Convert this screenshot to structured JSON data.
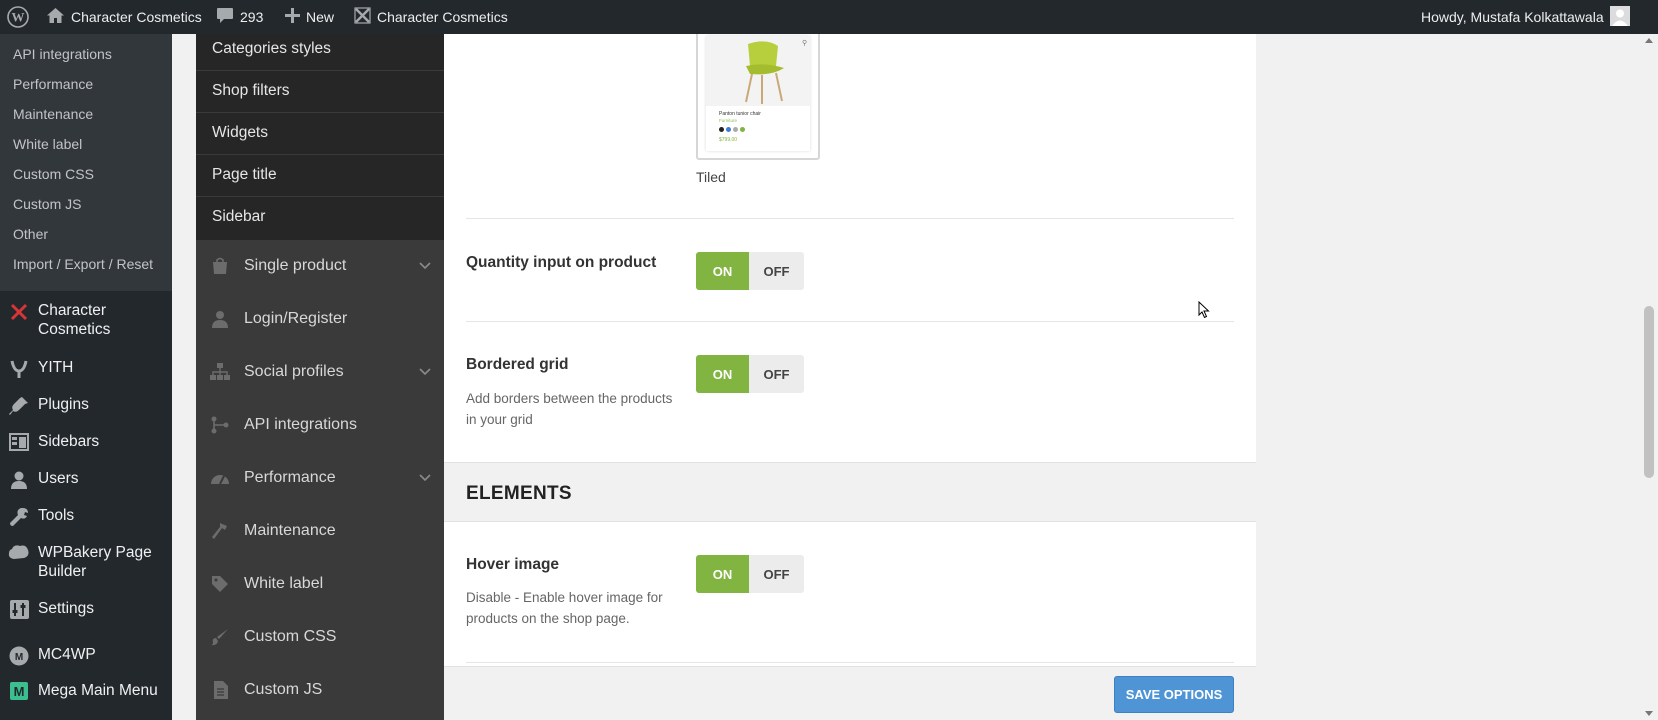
{
  "adminbar": {
    "site_name": "Character Cosmetics",
    "comments_count": "293",
    "new_label": "New",
    "theme_link": "Character Cosmetics",
    "greeting": "Howdy, Mustafa Kolkattawala"
  },
  "admin_submenu": [
    "API integrations",
    "Performance",
    "Maintenance",
    "White label",
    "Custom CSS",
    "Custom JS",
    "Other",
    "Import / Export / Reset"
  ],
  "admin_menu": [
    {
      "label": "Character Cosmetics",
      "icon": "theme-x-icon"
    },
    {
      "label": "YITH",
      "icon": "yith-icon"
    },
    {
      "label": "Plugins",
      "icon": "plugins-icon"
    },
    {
      "label": "Sidebars",
      "icon": "sidebars-icon"
    },
    {
      "label": "Users",
      "icon": "users-icon"
    },
    {
      "label": "Tools",
      "icon": "tools-icon"
    },
    {
      "label": "WPBakery Page Builder",
      "icon": "wpbakery-icon"
    },
    {
      "label": "Settings",
      "icon": "settings-icon"
    },
    {
      "label": "MC4WP",
      "icon": "mc4wp-icon"
    },
    {
      "label": "Mega Main Menu",
      "icon": "mega-menu-icon"
    }
  ],
  "options_subnav": [
    "Categories styles",
    "Shop filters",
    "Widgets",
    "Page title",
    "Sidebar"
  ],
  "options_nav": [
    {
      "label": "Single product",
      "icon": "bag-icon",
      "expandable": true
    },
    {
      "label": "Login/Register",
      "icon": "user-icon",
      "expandable": false
    },
    {
      "label": "Social profiles",
      "icon": "sitemap-icon",
      "expandable": true
    },
    {
      "label": "API integrations",
      "icon": "api-icon",
      "expandable": false
    },
    {
      "label": "Performance",
      "icon": "dashboard-icon",
      "expandable": true
    },
    {
      "label": "Maintenance",
      "icon": "hammer-icon",
      "expandable": false
    },
    {
      "label": "White label",
      "icon": "tag-icon",
      "expandable": false
    },
    {
      "label": "Custom CSS",
      "icon": "brush-icon",
      "expandable": false
    },
    {
      "label": "Custom JS",
      "icon": "file-icon",
      "expandable": false
    }
  ],
  "content": {
    "preview": {
      "label": "Tiled",
      "product_name": "Panton tunior chair",
      "product_category": "Furniture",
      "product_price": "$799.00"
    },
    "options": [
      {
        "title": "Quantity input on product",
        "description": "",
        "on": "ON",
        "off": "OFF",
        "value": "on"
      },
      {
        "title": "Bordered grid",
        "description": "Add borders between the products in your grid",
        "on": "ON",
        "off": "OFF",
        "value": "on"
      }
    ],
    "section_title": "ELEMENTS",
    "elements_options": [
      {
        "title": "Hover image",
        "description": "Disable - Enable hover image for products on the shop page.",
        "on": "ON",
        "off": "OFF",
        "value": "on"
      }
    ],
    "save_label": "SAVE OPTIONS"
  },
  "colors": {
    "accent_green": "#81b441",
    "save_blue": "#4f94d4",
    "admin_dark": "#23282d"
  }
}
